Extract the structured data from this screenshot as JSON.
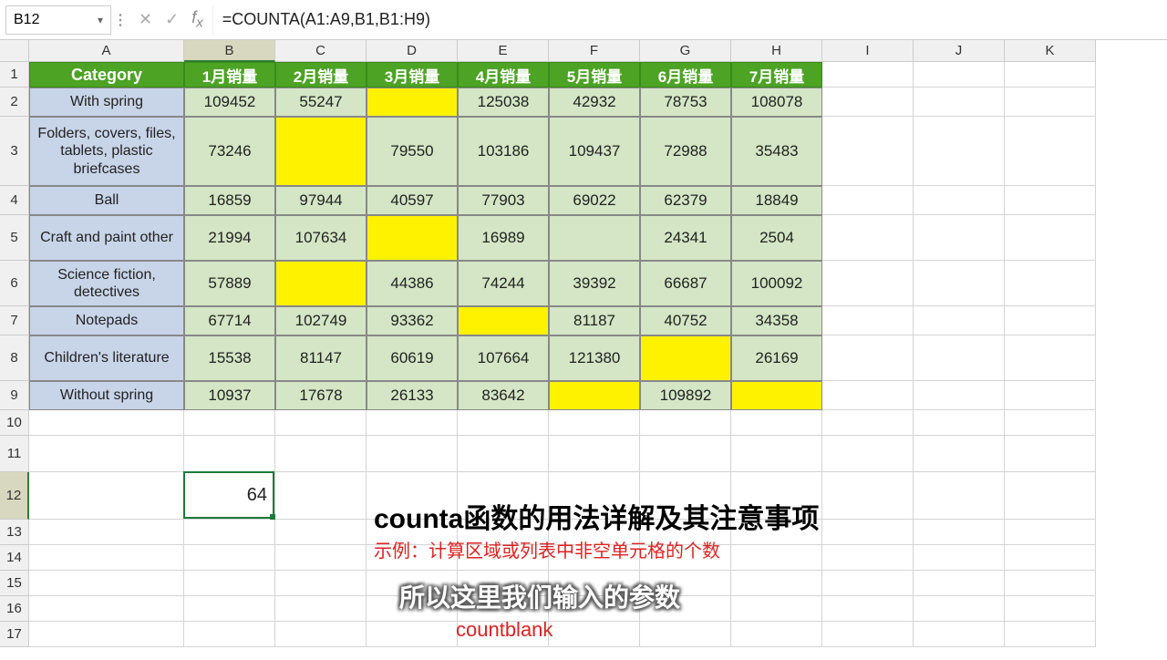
{
  "formula_bar": {
    "cell_ref": "B12",
    "formula": "=COUNTA(A1:A9,B1,B1:H9)"
  },
  "columns": [
    "A",
    "B",
    "C",
    "D",
    "E",
    "F",
    "G",
    "H",
    "I",
    "J",
    "K"
  ],
  "col_widths": {
    "A": 170,
    "B": 100,
    "C": 100,
    "D": 100,
    "E": 100,
    "F": 100,
    "G": 100,
    "H": 100,
    "I": 100,
    "J": 100,
    "K": 100
  },
  "row_heights": {
    "1": 28,
    "2": 32,
    "3": 76,
    "4": 32,
    "5": 50,
    "6": 50,
    "7": 32,
    "8": 50,
    "9": 32,
    "10": 28,
    "11": 40,
    "12": 52,
    "13": 28,
    "14": 28,
    "15": 28,
    "16": 28,
    "17": 28
  },
  "selected_col": "B",
  "selected_row": 12,
  "active_cell_value": "64",
  "headers": [
    "Category",
    "1月销量",
    "2月销量",
    "3月销量",
    "4月销量",
    "5月销量",
    "6月销量",
    "7月销量"
  ],
  "rows": [
    {
      "cat": "With spring",
      "v": [
        "109452",
        "55247",
        "",
        "125038",
        "42932",
        "78753",
        "108078"
      ],
      "yellow": [
        2
      ]
    },
    {
      "cat": "Folders, covers, files, tablets, plastic briefcases",
      "v": [
        "73246",
        "",
        "79550",
        "103186",
        "109437",
        "72988",
        "35483"
      ],
      "yellow": [
        1
      ]
    },
    {
      "cat": "Ball",
      "v": [
        "16859",
        "97944",
        "40597",
        "77903",
        "69022",
        "62379",
        "18849"
      ],
      "yellow": []
    },
    {
      "cat": "Craft and paint other",
      "v": [
        "21994",
        "107634",
        "",
        "16989",
        "",
        "24341",
        "2504"
      ],
      "yellow": [
        2
      ]
    },
    {
      "cat": "Science fiction, detectives",
      "v": [
        "57889",
        "",
        "44386",
        "74244",
        "39392",
        "66687",
        "100092"
      ],
      "yellow": [
        1
      ]
    },
    {
      "cat": "Notepads",
      "v": [
        "67714",
        "102749",
        "93362",
        "",
        "81187",
        "40752",
        "34358"
      ],
      "yellow": [
        3
      ]
    },
    {
      "cat": "Children's literature",
      "v": [
        "15538",
        "81147",
        "60619",
        "107664",
        "121380",
        "",
        "26169"
      ],
      "yellow": [
        5
      ]
    },
    {
      "cat": "Without spring",
      "v": [
        "10937",
        "17678",
        "26133",
        "83642",
        "",
        "109892",
        ""
      ],
      "yellow": [
        4,
        6
      ]
    }
  ],
  "overlays": {
    "title": "counta函数的用法详解及其注意事项",
    "subtitle": "示例：计算区域或列表中非空单元格的个数",
    "caption": "所以这里我们输入的参数",
    "fn": "countblank"
  }
}
